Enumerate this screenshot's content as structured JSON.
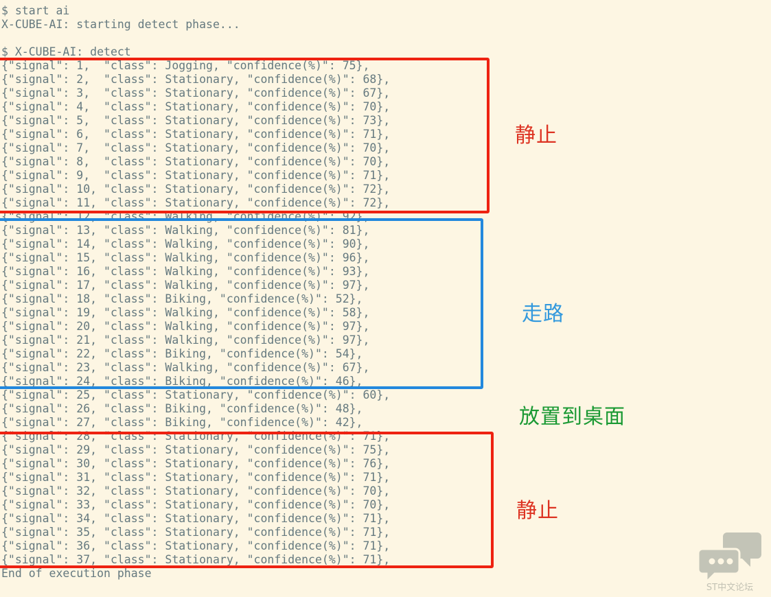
{
  "terminal": {
    "header_lines": [
      "$ start ai",
      "X-CUBE-AI: starting detect phase...",
      "",
      "$ X-CUBE-AI: detect"
    ],
    "footer_line": "End of execution phase",
    "records": [
      "{\"signal\": 1,  \"class\": Jogging, \"confidence(%)\": 75},",
      "{\"signal\": 2,  \"class\": Stationary, \"confidence(%)\": 68},",
      "{\"signal\": 3,  \"class\": Stationary, \"confidence(%)\": 67},",
      "{\"signal\": 4,  \"class\": Stationary, \"confidence(%)\": 70},",
      "{\"signal\": 5,  \"class\": Stationary, \"confidence(%)\": 73},",
      "{\"signal\": 6,  \"class\": Stationary, \"confidence(%)\": 71},",
      "{\"signal\": 7,  \"class\": Stationary, \"confidence(%)\": 70},",
      "{\"signal\": 8,  \"class\": Stationary, \"confidence(%)\": 70},",
      "{\"signal\": 9,  \"class\": Stationary, \"confidence(%)\": 71},",
      "{\"signal\": 10, \"class\": Stationary, \"confidence(%)\": 72},",
      "{\"signal\": 11, \"class\": Stationary, \"confidence(%)\": 72},",
      "{\"signal\": 12, \"class\": Walking, \"confidence(%)\": 92},",
      "{\"signal\": 13, \"class\": Walking, \"confidence(%)\": 81},",
      "{\"signal\": 14, \"class\": Walking, \"confidence(%)\": 90},",
      "{\"signal\": 15, \"class\": Walking, \"confidence(%)\": 96},",
      "{\"signal\": 16, \"class\": Walking, \"confidence(%)\": 93},",
      "{\"signal\": 17, \"class\": Walking, \"confidence(%)\": 97},",
      "{\"signal\": 18, \"class\": Biking, \"confidence(%)\": 52},",
      "{\"signal\": 19, \"class\": Walking, \"confidence(%)\": 58},",
      "{\"signal\": 20, \"class\": Walking, \"confidence(%)\": 97},",
      "{\"signal\": 21, \"class\": Walking, \"confidence(%)\": 97},",
      "{\"signal\": 22, \"class\": Biking, \"confidence(%)\": 54},",
      "{\"signal\": 23, \"class\": Walking, \"confidence(%)\": 67},",
      "{\"signal\": 24, \"class\": Biking, \"confidence(%)\": 46},",
      "{\"signal\": 25, \"class\": Stationary, \"confidence(%)\": 60},",
      "{\"signal\": 26, \"class\": Biking, \"confidence(%)\": 48},",
      "{\"signal\": 27, \"class\": Biking, \"confidence(%)\": 42},",
      "{\"signal\": 28, \"class\": Stationary, \"confidence(%)\": 71},",
      "{\"signal\": 29, \"class\": Stationary, \"confidence(%)\": 75},",
      "{\"signal\": 30, \"class\": Stationary, \"confidence(%)\": 76},",
      "{\"signal\": 31, \"class\": Stationary, \"confidence(%)\": 71},",
      "{\"signal\": 32, \"class\": Stationary, \"confidence(%)\": 70},",
      "{\"signal\": 33, \"class\": Stationary, \"confidence(%)\": 70},",
      "{\"signal\": 34, \"class\": Stationary, \"confidence(%)\": 71},",
      "{\"signal\": 35, \"class\": Stationary, \"confidence(%)\": 71},",
      "{\"signal\": 36, \"class\": Stationary, \"confidence(%)\": 71},",
      "{\"signal\": 37, \"class\": Stationary, \"confidence(%)\": 71},"
    ]
  },
  "annotations": [
    {
      "id": "stationary-1",
      "label": "静止",
      "color": "#dd3322",
      "box_color": "#ee2211",
      "covers_signals": "1-11"
    },
    {
      "id": "walking",
      "label": "走路",
      "color": "#3399dd",
      "box_color": "#2288dd",
      "covers_signals": "12-24"
    },
    {
      "id": "desk",
      "label": "放置到桌面",
      "color": "#1a9933",
      "box_color": "",
      "covers_signals": "25-27"
    },
    {
      "id": "stationary-2",
      "label": "静止",
      "color": "#dd3322",
      "box_color": "#ee2211",
      "covers_signals": "28-37"
    }
  ],
  "watermark": {
    "text": "ST中文论坛",
    "color": "#b9b9ac"
  },
  "theme": {
    "background": "#fdf6e3",
    "text": "#65797f",
    "red": "#ee2211",
    "blue": "#2288dd",
    "green": "#1a9933"
  }
}
